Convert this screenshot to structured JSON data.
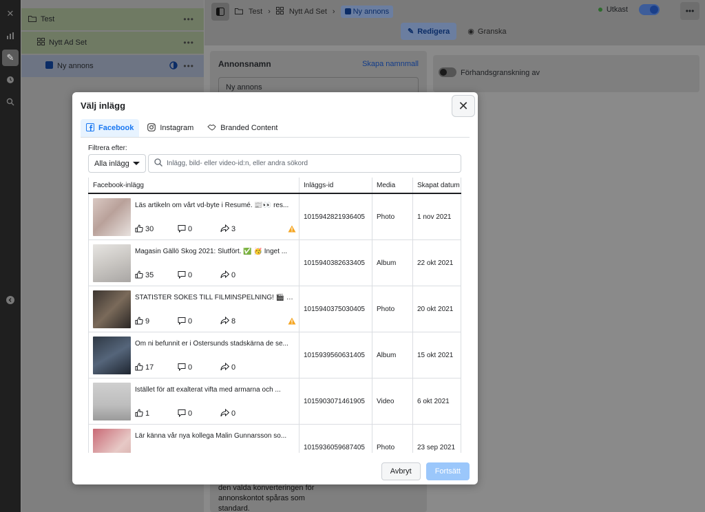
{
  "rail": {
    "icons": [
      "close-icon",
      "bar-chart-icon",
      "pencil-icon",
      "clock-icon",
      "search-icon",
      "chevron-left-icon"
    ]
  },
  "tree": {
    "campaign": "Test",
    "adset": "Nytt Ad Set",
    "ad": "Ny annons",
    "more": "•••"
  },
  "topbar": {
    "breadcrumbs": [
      "Test",
      "Nytt Ad Set",
      "Ny annons"
    ],
    "status": "Utkast",
    "more": "•••",
    "edit_label": "Redigera",
    "review_label": "Granska"
  },
  "editor": {
    "ad_name_title": "Annonsnamn",
    "template_link": "Skapa namnmall",
    "ad_name_value": "Ny annons",
    "footer_text": "den valda konverteringen för annonskontot spåras som standard.",
    "preview_label": "Förhandsgranskning av"
  },
  "modal": {
    "title": "Välj inlägg",
    "tabs": [
      "Facebook",
      "Instagram",
      "Branded Content"
    ],
    "filter_label": "Filtrera efter:",
    "dropdown_value": "Alla inlägg",
    "search_placeholder": "Inlägg, bild- eller video-id:n, eller andra sökord",
    "columns": [
      "Facebook-inlägg",
      "Inläggs-id",
      "Media",
      "Skapat datum"
    ],
    "rows": [
      {
        "text": "Läs artikeln om vårt vd-byte i Resumé. 📰👀 res...",
        "likes": "30",
        "comments": "0",
        "shares": "3",
        "id": "1015942821936405",
        "media": "Photo",
        "date": "1 nov 2021",
        "warning": true
      },
      {
        "text": "Magasin Gällö Skog 2021: Slutfört. ✅ 🥳 Inget ...",
        "likes": "35",
        "comments": "0",
        "shares": "0",
        "id": "1015940382633405",
        "media": "Album",
        "date": "22 okt 2021",
        "warning": false
      },
      {
        "text": "STATISTER SÖKES TILL FILMINSPELNING! 🎬 F...",
        "likes": "9",
        "comments": "0",
        "shares": "8",
        "id": "1015940375030405",
        "media": "Photo",
        "date": "20 okt 2021",
        "warning": true
      },
      {
        "text": "Om ni befunnit er i Östersunds stadskärna de se...",
        "likes": "17",
        "comments": "0",
        "shares": "0",
        "id": "1015939560631405",
        "media": "Album",
        "date": "15 okt 2021",
        "warning": false
      },
      {
        "text": "Istället för att exalterat vifta med armarna och ...",
        "likes": "1",
        "comments": "0",
        "shares": "0",
        "id": "1015903071461905",
        "media": "Video",
        "date": "6 okt 2021",
        "warning": false
      },
      {
        "text": "Lär känna vår nya kollega Malin Gunnarsson so...",
        "likes": "",
        "comments": "",
        "shares": "",
        "id": "1015936059687405",
        "media": "Photo",
        "date": "23 sep 2021",
        "warning": false
      }
    ],
    "cancel_label": "Avbryt",
    "continue_label": "Fortsätt"
  },
  "colors": {
    "accent": "#1877f2",
    "warning": "#f5a623",
    "continue_disabled": "#9bc7fb"
  }
}
